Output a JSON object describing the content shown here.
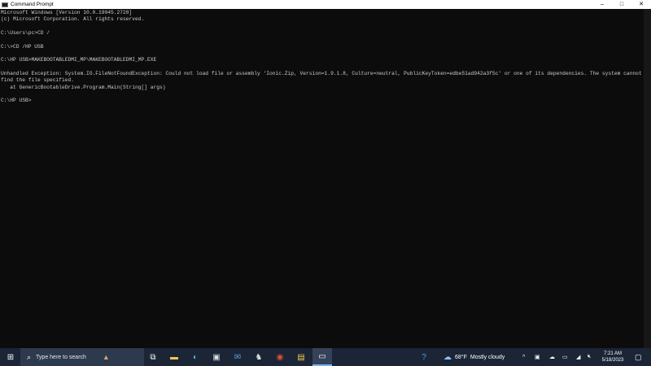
{
  "window": {
    "title": "Command Prompt",
    "controls": {
      "minimize": "–",
      "maximize": "□",
      "close": "✕"
    }
  },
  "console": {
    "lines": [
      "Microsoft Windows [Version 10.0.19045.2728]",
      "(c) Microsoft Corporation. All rights reserved.",
      "",
      "C:\\Users\\pc>CD /",
      "",
      "C:\\>CD /HP USB",
      "",
      "C:\\HP USB>MAKEBOOTABLEDMI_MP\\MAKEBOOTABLEDMI_MP.EXE",
      "",
      "Unhandled Exception: System.IO.FileNotFoundException: Could not load file or assembly 'Ionic.Zip, Version=1.9.1.8, Culture=neutral, PublicKeyToken=edbe51ad942a3f5c' or one of its dependencies. The system cannot",
      "find the file specified.",
      "   at GenericBootableDrive.Program.Main(String[] args)",
      "",
      "C:\\HP USB>"
    ]
  },
  "taskbar": {
    "search_placeholder": "Type here to search",
    "weather": {
      "temp": "68°F",
      "condition": "Mostly cloudy"
    },
    "clock": {
      "time": "7:21 AM",
      "date": "5/18/2023"
    }
  }
}
